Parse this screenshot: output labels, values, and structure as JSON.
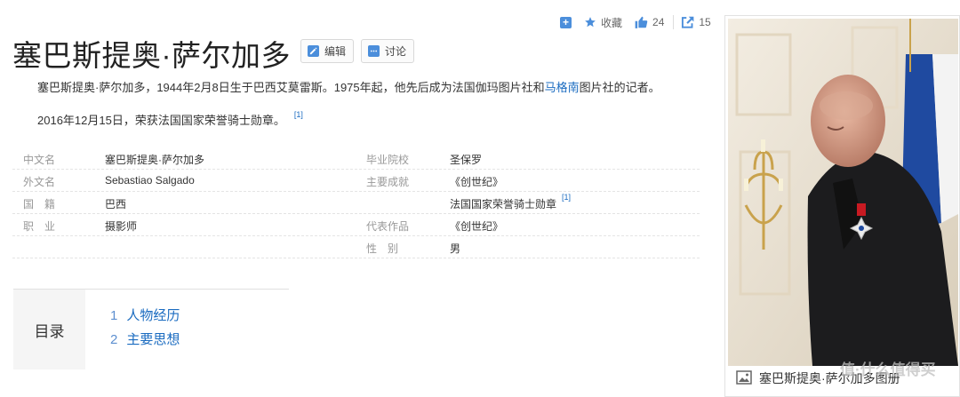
{
  "actions": {
    "collect_label": "收藏",
    "like_count": "24",
    "share_count": "15"
  },
  "title": "塞巴斯提奥·萨尔加多",
  "title_buttons": {
    "edit": "编辑",
    "discuss": "讨论"
  },
  "summary": {
    "p1_before": "塞巴斯提奥·萨尔加多，1944年2月8日生于巴西艾莫雷斯。1975年起，他先后成为法国伽玛图片社和",
    "p1_link": "马格南",
    "p1_after": "图片社的记者。",
    "p2": "2016年12月15日，荣获法国国家荣誉骑士勋章。",
    "p2_ref": "[1]"
  },
  "info": {
    "left": [
      {
        "label": "中文名",
        "value": "塞巴斯提奥·萨尔加多"
      },
      {
        "label": "外文名",
        "value": "Sebastiao Salgado"
      },
      {
        "label": "国　籍",
        "value": "巴西"
      },
      {
        "label": "职　业",
        "value": "摄影师"
      }
    ],
    "right": [
      {
        "label": "毕业院校",
        "value": "圣保罗"
      },
      {
        "label": "主要成就",
        "value": "《创世纪》"
      },
      {
        "label": "",
        "value": "法国国家荣誉骑士勋章",
        "ref": "[1]"
      },
      {
        "label": "代表作品",
        "value": "《创世纪》"
      },
      {
        "label": "性　别",
        "value": "男"
      }
    ]
  },
  "catalog": {
    "heading": "目录",
    "items": [
      {
        "num": "1",
        "label": "人物经历"
      },
      {
        "num": "2",
        "label": "主要思想"
      }
    ]
  },
  "photo": {
    "caption": "塞巴斯提奥·萨尔加多图册"
  },
  "watermark": "值·什么值得买",
  "colors": {
    "link": "#1a6bc0",
    "accent": "#4b8edb",
    "label_gray": "#999999"
  }
}
